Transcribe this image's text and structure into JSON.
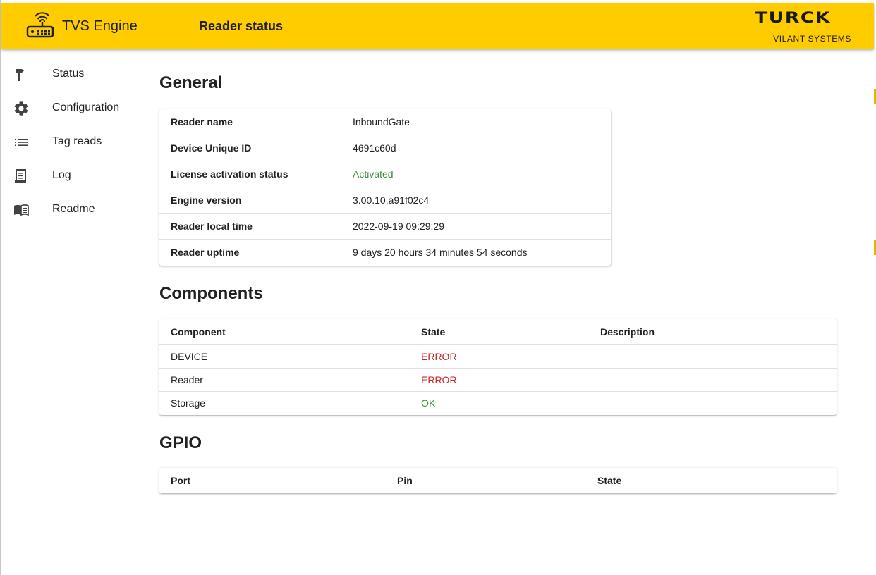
{
  "app": {
    "title": "TVS Engine",
    "page_title": "Reader status",
    "icon": "router-icon",
    "brand_color": "#ffcc00"
  },
  "logo": {
    "word": "TURCK",
    "subtitle": "VILANT SYSTEMS"
  },
  "sidebar": {
    "items": [
      {
        "label": "Status",
        "icon": "hammer-icon"
      },
      {
        "label": "Configuration",
        "icon": "gear-icon"
      },
      {
        "label": "Tag reads",
        "icon": "list-icon"
      },
      {
        "label": "Log",
        "icon": "document-icon"
      },
      {
        "label": "Readme",
        "icon": "book-icon"
      }
    ]
  },
  "general": {
    "title": "General",
    "rows": [
      {
        "key": "Reader name",
        "value": "InboundGate"
      },
      {
        "key": "Device Unique ID",
        "value": "4691c60d"
      },
      {
        "key": "License activation status",
        "value": "Activated",
        "status_color": "#3c8b3c"
      },
      {
        "key": "Engine version",
        "value": "3.00.10.a91f02c4"
      },
      {
        "key": "Reader local time",
        "value": "2022-09-19 09:29:29"
      },
      {
        "key": "Reader uptime",
        "value": "9 days 20 hours 34 minutes 54 seconds"
      }
    ]
  },
  "components": {
    "title": "Components",
    "headers": [
      "Component",
      "State",
      "Description"
    ],
    "rows": [
      {
        "component": "DEVICE",
        "state": "ERROR",
        "description": ""
      },
      {
        "component": "Reader",
        "state": "ERROR",
        "description": ""
      },
      {
        "component": "Storage",
        "state": "OK",
        "description": ""
      }
    ],
    "colors": {
      "error": "#c62828",
      "ok": "#3c8b3c"
    }
  },
  "gpio": {
    "title": "GPIO",
    "headers": [
      "Port",
      "Pin",
      "State"
    ],
    "rows": []
  }
}
